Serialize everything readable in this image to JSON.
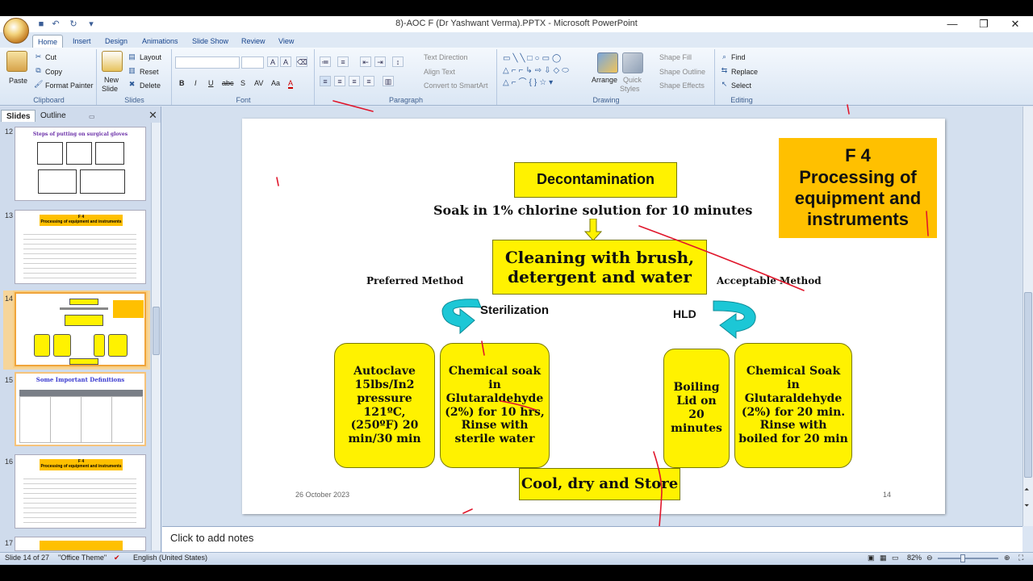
{
  "window": {
    "title": "8)-AOC F (Dr Yashwant Verma).PPTX - Microsoft PowerPoint",
    "minimize": "—",
    "restore": "❐",
    "close": "✕"
  },
  "tabs": [
    "Home",
    "Insert",
    "Design",
    "Animations",
    "Slide Show",
    "Review",
    "View"
  ],
  "ribbon": {
    "clipboard": {
      "label": "Clipboard",
      "paste": "Paste",
      "cut": "Cut",
      "copy": "Copy",
      "format_painter": "Format Painter"
    },
    "slides": {
      "label": "Slides",
      "new_slide_1": "New",
      "new_slide_2": "Slide",
      "layout": "Layout",
      "reset": "Reset",
      "delete": "Delete"
    },
    "font": {
      "label": "Font",
      "bold": "B",
      "italic": "I",
      "underline": "U",
      "strike": "abc",
      "shadow": "S",
      "spacing": "AV",
      "case": "Aa",
      "color": "A"
    },
    "paragraph": {
      "label": "Paragraph",
      "text_direction": "Text Direction",
      "align_text": "Align Text",
      "smartart": "Convert to SmartArt"
    },
    "drawing": {
      "label": "Drawing",
      "arrange": "Arrange",
      "quick_styles_1": "Quick",
      "quick_styles_2": "Styles",
      "shape_fill": "Shape Fill",
      "shape_outline": "Shape Outline",
      "shape_effects": "Shape Effects"
    },
    "editing": {
      "label": "Editing",
      "find": "Find",
      "replace": "Replace",
      "select": "Select"
    }
  },
  "panel": {
    "tab_slides": "Slides",
    "tab_outline": "Outline",
    "slide_numbers": [
      "12",
      "13",
      "14",
      "15",
      "16",
      "17"
    ],
    "thumb12_title": "Steps of putting on surgical gloves",
    "thumb13_title": "F 4",
    "thumb13_sub": "Processing of equipment and instruments",
    "thumb15_title": "Some Important Definitions",
    "thumb16_title": "F 4",
    "thumb16_sub": "Processing of equipment and instruments"
  },
  "slide": {
    "decontamination": "Decontamination",
    "soak": "Soak in 1% chlorine solution for 10 minutes",
    "cleaning": "Cleaning with brush, detergent and water",
    "preferred": "Preferred Method",
    "acceptable": "Acceptable Method",
    "sterilization": "Sterilization",
    "hld": "HLD",
    "autoclave": "Autoclave 15lbs/In2 pressure 121ºC, (250ºF) 20 min/30 min",
    "chemical_glut": "Chemical soak in Glutaraldehyde (2%) for 10 hrs, Rinse with sterile water",
    "boiling": "Boiling Lid on 20 minutes",
    "chemical_hld": "Chemical Soak in Glutaraldehyde (2%) for 20 min. Rinse with boiled for 20 min",
    "cool": "Cool, dry and Store",
    "f4_line1": "F 4",
    "f4_line2": "Processing of equipment and instruments",
    "date": "26 October  2023",
    "page": "14"
  },
  "notes": {
    "placeholder": "Click to add notes"
  },
  "status": {
    "slide_info": "Slide 14 of 27",
    "theme": "\"Office Theme\"",
    "language": "English (United States)",
    "zoom": "82%"
  },
  "colors": {
    "yellow": "#fff200",
    "orange": "#ffc000",
    "cyan": "#1cc7d6",
    "ink": "#e0162b"
  }
}
